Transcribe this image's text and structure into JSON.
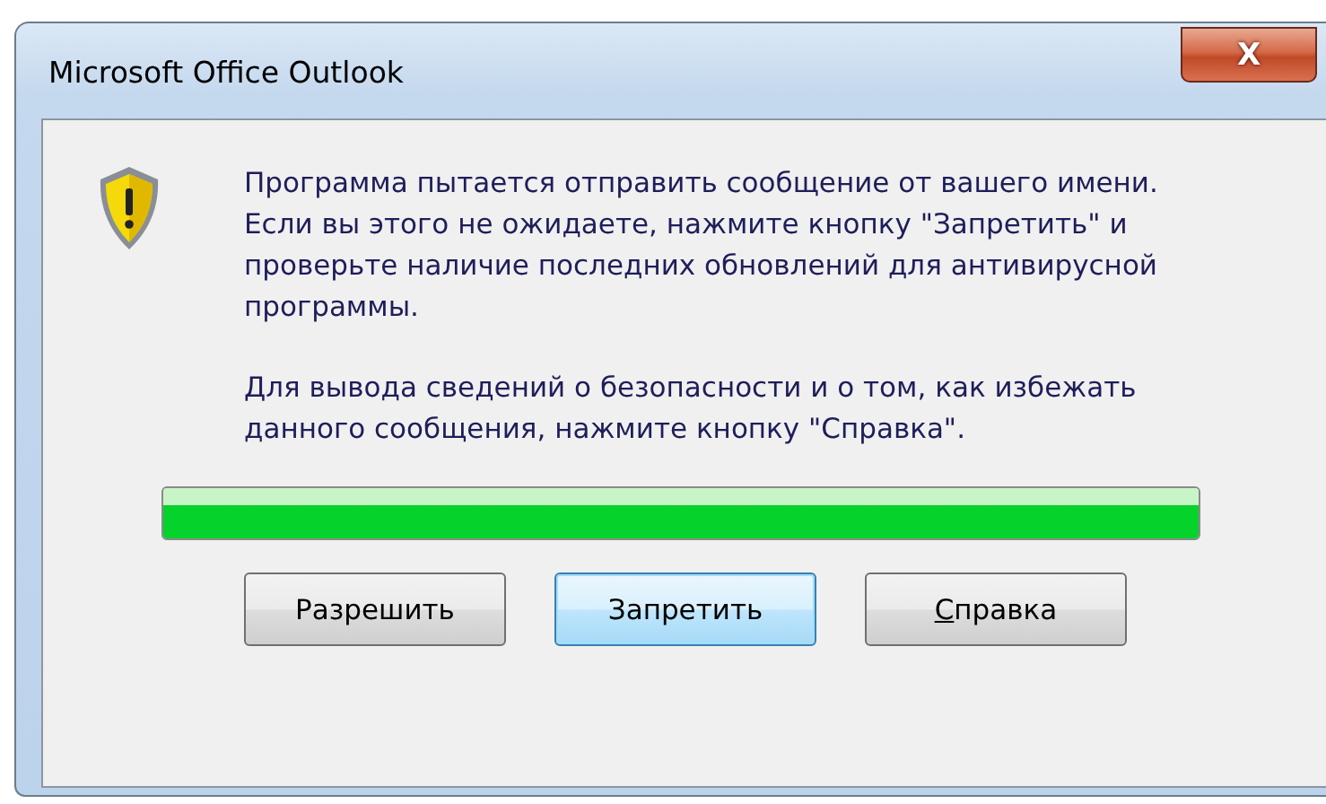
{
  "window": {
    "title": "Microsoft Office Outlook",
    "close_label": "X"
  },
  "message": {
    "paragraphs": [
      "Программа пытается отправить сообщение от вашего имени. Если вы этого не ожидаете, нажмите кнопку \"Запретить\" и проверьте наличие последних обновлений для антивирусной программы.",
      "Для вывода сведений о безопасности и о том, как избежать данного сообщения, нажмите кнопку \"Справка\"."
    ]
  },
  "progress": {
    "level": 1
  },
  "buttons": [
    {
      "label": "Разрешить",
      "default": false,
      "first_letter_underlined": false
    },
    {
      "label": "Запретить",
      "default": true,
      "first_letter_underlined": false
    },
    {
      "label": "Справка",
      "default": false,
      "first_letter_underlined": true
    }
  ]
}
